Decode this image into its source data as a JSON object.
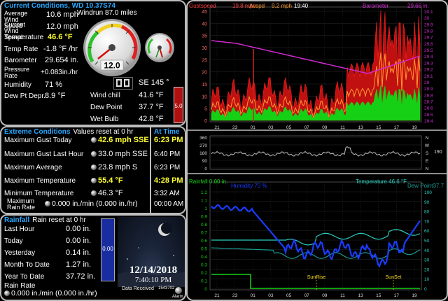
{
  "current": {
    "title": "Current Conditions, WD 10.37S74",
    "avg_wind_label": "Average Wind Speed",
    "avg_wind_value": "10.6 mph",
    "windrun": "Windrun 87.0 miles",
    "cur_wind_label": "Current Wind Speed",
    "cur_wind_value": "12.0 mph",
    "temp_label": "Temperature",
    "temp_value": "46.6 °F",
    "temp_rate_label": "Temp Rate",
    "temp_rate_value": "-1.8 °F /hr",
    "baro_label": "Barometer",
    "baro_value": "29.654 in.",
    "press_rate_label": "Pressure Rate",
    "press_rate_value": "+0.083in./hr",
    "humidity_label": "Humidity",
    "humidity_value": "71 %",
    "dew_depr_label": "Dew Pt Depr.",
    "dew_depr_value": "8.9 °F",
    "gauge_value": "12.0",
    "dir_value": "SE  145 °",
    "wind_chill_label": "Wind chill",
    "wind_chill_value": "41.6 °F",
    "dew_point_label": "Dew Point",
    "dew_point_value": "37.7 °F",
    "wet_bulb_label": "Wet Bulb",
    "wet_bulb_value": "42.8 °F",
    "uv_value": "5.0"
  },
  "extreme": {
    "title": "Extreme Conditions",
    "subtitle": "Values reset at 0 hr",
    "at_time_title": "At Time",
    "rows": [
      {
        "label": "Maximum Gust Today",
        "value": "42.6 mph SSE",
        "time": "6:23 PM",
        "hl": true
      },
      {
        "label": "Maximum Gust Last Hour",
        "value": "33.0 mph SSE",
        "time": "6:40 PM",
        "hl": false
      },
      {
        "label": "Maximum Average",
        "value": "23.8 mph   S",
        "time": "6:23 PM",
        "hl": false
      },
      {
        "label": "Maximum Temperature",
        "value": "55.4 °F",
        "time": "4:28 PM",
        "hl": true
      },
      {
        "label": "Minimum Temperature",
        "value": "46.3 °F",
        "time": "3:32 AM",
        "hl": false
      },
      {
        "label": "Maximum Rain Rate",
        "value": "0.000 in./min (0.000 in./hr)",
        "time": "00:00 AM",
        "hl": false
      }
    ]
  },
  "rainfall": {
    "title": "Rainfall",
    "subtitle": "Rain reset at 0 hr",
    "rows": [
      {
        "label": "Last Hour",
        "value": "0.00 in."
      },
      {
        "label": "Today",
        "value": "0.00 in."
      },
      {
        "label": "Yesterday",
        "value": "0.14 in."
      },
      {
        "label": "Month To Date",
        "value": "1.27 in."
      },
      {
        "label": "Year To Date",
        "value": "37.72 in."
      }
    ],
    "rate_label": "Rain Rate",
    "rate_value": "0.000 in./min (0.000 in./hr)",
    "gauge_value": "0.00"
  },
  "moon": {
    "date": "12/14/2018",
    "time": "7:40:10 PM",
    "data_received_label": "Data Received",
    "data_received_value": "1543702",
    "alarm_label": "Alarm"
  },
  "graphs": {
    "top": {
      "label_gust": "Gustspeed",
      "label_gust_val": "19.8 mph",
      "label_avg": "Avspd",
      "label_avg_val": "9.2 mph",
      "label_time": "19:40",
      "label_baro": "Barometer",
      "label_baro_val": "29.66 in.",
      "left_ticks": [
        "45",
        "40",
        "35",
        "30",
        "25",
        "20",
        "15",
        "10",
        "5",
        "0"
      ],
      "right_ticks": [
        "30.1",
        "30",
        "29.9",
        "29.8",
        "29.7",
        "29.6",
        "29.5",
        "29.4",
        "29.3",
        "29.2",
        "29.1",
        "29",
        "28.9",
        "28.8",
        "28.7",
        "28.6",
        "28.5",
        "28.4"
      ],
      "x_ticks": [
        "21",
        "23",
        "01",
        "03",
        "05",
        "07",
        "09",
        "11",
        "13",
        "15",
        "17",
        "19"
      ]
    },
    "dir": {
      "left_ticks": [
        "360",
        "270",
        "180",
        "90",
        "0"
      ],
      "compass": [
        "N",
        "W",
        "S",
        "E",
        "N"
      ],
      "value": "190"
    },
    "bottom": {
      "label_rain": "Rainfall  0.00 in.",
      "label_hum": "Humidity  70 %",
      "label_temp": "Temperature 46.6 °F",
      "label_dew": "Dew Point37.7",
      "left_ticks": [
        "1.2",
        "1.1",
        "1",
        "0.9",
        "0.8",
        "0.7",
        "0.6",
        "0.5",
        "0.4",
        "0.3",
        "0.2",
        "0.1",
        "0"
      ],
      "right_ticks": [
        "100",
        "90",
        "80",
        "70",
        "60",
        "50",
        "40",
        "30",
        "20",
        "10",
        "0"
      ],
      "x_ticks": [
        "21",
        "23",
        "01",
        "03",
        "05",
        "07",
        "09",
        "11",
        "13",
        "15",
        "17",
        "19"
      ],
      "sunrise": "SunRise",
      "sunset": "SunSet"
    }
  },
  "colors": {
    "title_blue": "#29a8ff",
    "panel_border": "#bdbdbd",
    "highlight": "#ffff33",
    "graph_red": "#ff2020",
    "graph_orange": "#ff9a30",
    "graph_green": "#16d016",
    "graph_magenta": "#d02ad0",
    "graph_blue": "#1a3cff",
    "graph_teal": "#2ad0c0"
  }
}
